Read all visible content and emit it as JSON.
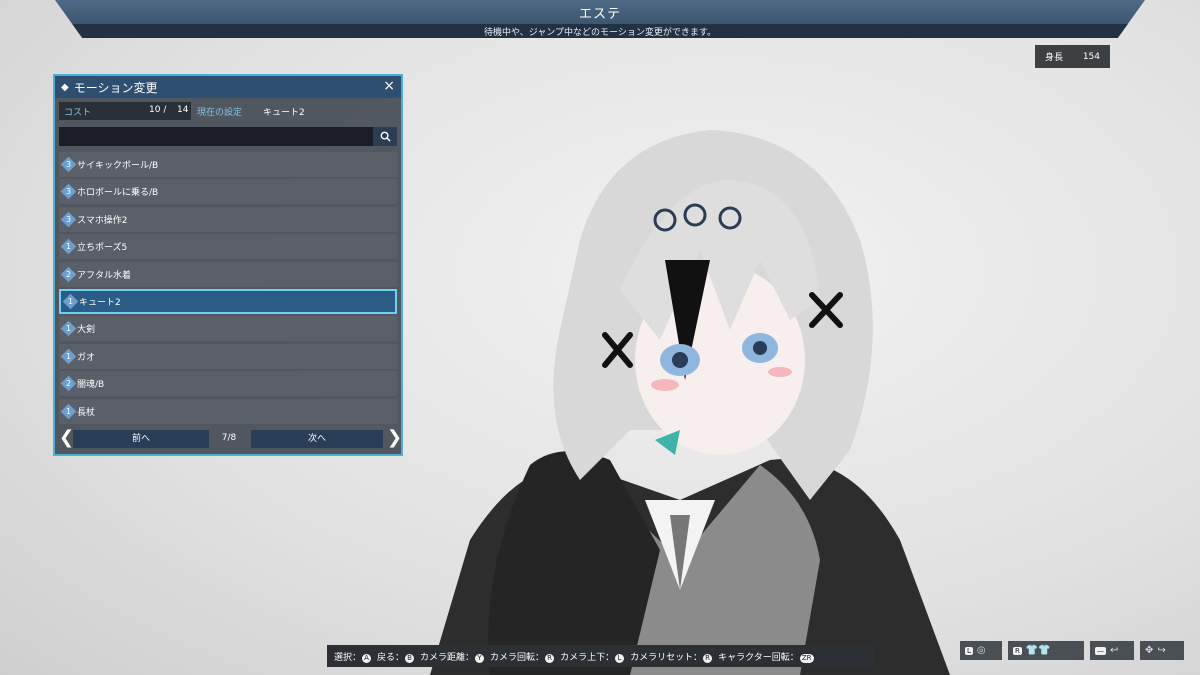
{
  "header": {
    "title": "エステ",
    "subtitle": "待機中や、ジャンプ中などのモーション変更ができます。"
  },
  "height_badge": {
    "label": "身長",
    "value": "154"
  },
  "panel": {
    "title": "モーション変更",
    "close_glyph": "×",
    "cost_label": "コスト",
    "cost_current": "10 /",
    "cost_max": "14",
    "setting_label": "現在の設定",
    "setting_value": "キュート2",
    "search_placeholder": "",
    "search_icon": "search-icon",
    "items": [
      {
        "cost": "3",
        "label": "サイキックボール/B"
      },
      {
        "cost": "3",
        "label": "ホロボールに乗る/B"
      },
      {
        "cost": "3",
        "label": "スマホ操作2"
      },
      {
        "cost": "1",
        "label": "立ちポーズ5"
      },
      {
        "cost": "2",
        "label": "アフタル水着"
      },
      {
        "cost": "1",
        "label": "キュート2",
        "selected": true
      },
      {
        "cost": "1",
        "label": "大剣"
      },
      {
        "cost": "1",
        "label": "ガオ"
      },
      {
        "cost": "2",
        "label": "闇魂/B"
      },
      {
        "cost": "1",
        "label": "長杖"
      }
    ],
    "pager": {
      "prev_label": "前へ",
      "next_label": "次へ",
      "page_text": "7/8"
    }
  },
  "controls": [
    {
      "label": "選択：",
      "key": "A"
    },
    {
      "label": "戻る：",
      "key": "B"
    },
    {
      "label": "カメラ距離：",
      "key": "Y"
    },
    {
      "label": "カメラ回転：",
      "key": "R"
    },
    {
      "label": "カメラ上下：",
      "key": "L"
    },
    {
      "label": "カメラリセット：",
      "key": "R"
    },
    {
      "label": "キャラクター回転：",
      "key": "ZR"
    }
  ],
  "right_controls": [
    {
      "key": "L",
      "glyph": "◎"
    },
    {
      "key": "R",
      "glyph": "👕👕"
    },
    {
      "key": "—",
      "glyph": "↩"
    },
    {
      "key": "✥",
      "glyph": "↪"
    }
  ],
  "colors": {
    "accent": "#4ab0d8",
    "panel_header": "#2e4f70",
    "selected_bg": "#2a5c86"
  }
}
